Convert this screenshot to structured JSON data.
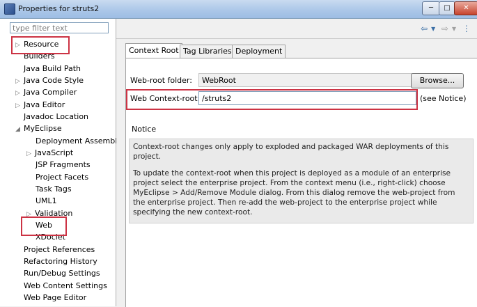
{
  "window": {
    "title": "Properties for struts2",
    "min_glyph": "─",
    "max_glyph": "□",
    "close_glyph": "✕"
  },
  "sidebar": {
    "filter_placeholder": "type filter text",
    "items": [
      {
        "label": "Resource",
        "arrow": "▷"
      },
      {
        "label": "Builders",
        "arrow": ""
      },
      {
        "label": "Java Build Path",
        "arrow": ""
      },
      {
        "label": "Java Code Style",
        "arrow": "▷"
      },
      {
        "label": "Java Compiler",
        "arrow": "▷"
      },
      {
        "label": "Java Editor",
        "arrow": "▷"
      },
      {
        "label": "Javadoc Location",
        "arrow": ""
      },
      {
        "label": "MyEclipse",
        "arrow": "◢"
      },
      {
        "label": "Deployment Assembl",
        "arrow": ""
      },
      {
        "label": "JavaScript",
        "arrow": "▷"
      },
      {
        "label": "JSP Fragments",
        "arrow": ""
      },
      {
        "label": "Project Facets",
        "arrow": ""
      },
      {
        "label": "Task Tags",
        "arrow": ""
      },
      {
        "label": "UML1",
        "arrow": ""
      },
      {
        "label": "Validation",
        "arrow": "▷"
      },
      {
        "label": "Web",
        "arrow": ""
      },
      {
        "label": "XDoclet",
        "arrow": ""
      },
      {
        "label": "Project References",
        "arrow": ""
      },
      {
        "label": "Refactoring History",
        "arrow": ""
      },
      {
        "label": "Run/Debug Settings",
        "arrow": ""
      },
      {
        "label": "Web Content Settings",
        "arrow": ""
      },
      {
        "label": "Web Page Editor",
        "arrow": ""
      }
    ]
  },
  "nav": {
    "back_glyph": "⇦",
    "forward_glyph": "⇨",
    "dropdown_glyph": "▾",
    "menu_glyph": "⋮"
  },
  "tabs": [
    "Context Root",
    "Tag Libraries",
    "Deployment"
  ],
  "form": {
    "webroot_label": "Web-root folder:",
    "webroot_value": "WebRoot",
    "browse_label": "Browse...",
    "context_label": "Web Context-root:",
    "context_value": "/struts2",
    "see_notice": "(see Notice)"
  },
  "notice": {
    "heading": "Notice",
    "para1": "Context-root changes only apply to exploded and packaged WAR deployments of this project.",
    "para2": "To update the context-root when this project is deployed as a module of an enterprise project select the enterprise project. From the context menu (i.e., right-click) choose MyEclipse > Add/Remove Module dialog. From this dialog remove the web-project from the enterprise project. Then re-add the web-project to the enterprise project while specifying the new context-root."
  },
  "colors": {
    "highlight_box": "#cc3344",
    "title_bar": "#aac6e8"
  }
}
